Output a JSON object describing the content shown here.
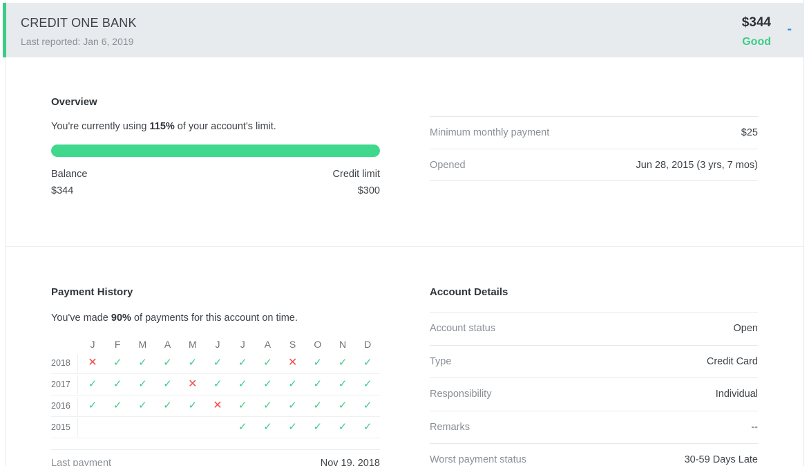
{
  "header": {
    "bank_name": "CREDIT ONE BANK",
    "last_reported": "Last reported: Jan 6, 2019",
    "balance": "$344",
    "status": "Good",
    "toggle_symbol": "-"
  },
  "overview": {
    "title": "Overview",
    "util_prefix": "You're currently using ",
    "util_value": "115%",
    "util_suffix": " of your account's limit.",
    "utilization_fraction": 1.0,
    "balance_label": "Balance",
    "balance_value": "$344",
    "credit_limit_label": "Credit limit",
    "credit_limit_value": "$300",
    "rows": [
      {
        "label": "Minimum monthly payment",
        "value": "$25"
      },
      {
        "label": "Opened",
        "value": "Jun 28, 2015 (3 yrs, 7 mos)"
      }
    ]
  },
  "payment_history": {
    "title": "Payment History",
    "ontime_prefix": "You've made ",
    "ontime_value": "90%",
    "ontime_suffix": " of payments for this account on time.",
    "months": [
      "J",
      "F",
      "M",
      "A",
      "M",
      "J",
      "J",
      "A",
      "S",
      "O",
      "N",
      "D"
    ],
    "years": [
      {
        "year": "2018",
        "cells": [
          "late",
          "ok",
          "ok",
          "ok",
          "ok",
          "ok",
          "ok",
          "ok",
          "late",
          "ok",
          "ok",
          "ok"
        ]
      },
      {
        "year": "2017",
        "cells": [
          "ok",
          "ok",
          "ok",
          "ok",
          "late",
          "ok",
          "ok",
          "ok",
          "ok",
          "ok",
          "ok",
          "ok"
        ]
      },
      {
        "year": "2016",
        "cells": [
          "ok",
          "ok",
          "ok",
          "ok",
          "ok",
          "late",
          "ok",
          "ok",
          "ok",
          "ok",
          "ok",
          "ok"
        ]
      },
      {
        "year": "2015",
        "cells": [
          "",
          "",
          "",
          "",
          "",
          "",
          "ok",
          "ok",
          "ok",
          "ok",
          "ok",
          "ok"
        ]
      }
    ],
    "ok_symbol": "✓",
    "late_symbol": "✕",
    "last_payment_label": "Last payment",
    "last_payment_value": "Nov 19, 2018"
  },
  "account_details": {
    "title": "Account Details",
    "rows": [
      {
        "label": "Account status",
        "value": "Open"
      },
      {
        "label": "Type",
        "value": "Credit Card"
      },
      {
        "label": "Responsibility",
        "value": "Individual"
      },
      {
        "label": "Remarks",
        "value": "--"
      },
      {
        "label": "Worst payment status",
        "value": "30-59 Days Late"
      }
    ]
  },
  "colors": {
    "accent_green": "#3ccc86",
    "late_red": "#ef4f4f",
    "toggle_blue": "#3a8fd8"
  }
}
